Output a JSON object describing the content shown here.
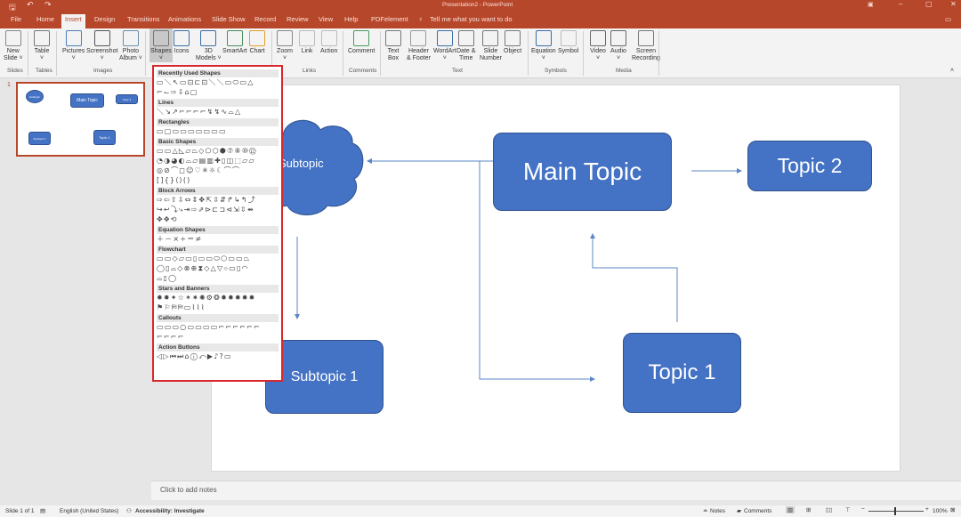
{
  "window": {
    "title": "Presentation2 - PowerPoint"
  },
  "tabs": [
    "File",
    "Home",
    "Insert",
    "Design",
    "Transitions",
    "Animations",
    "Slide Show",
    "Record",
    "Review",
    "View",
    "Help",
    "PDFelement"
  ],
  "active_tab": "Insert",
  "tell_me": "Tell me what you want to do",
  "ribbon": {
    "buttons": [
      {
        "label": "New\nSlide ˅",
        "icon": "new-slide-icon"
      },
      {
        "label": "Table\n˅",
        "icon": "table-icon"
      },
      {
        "label": "Pictures\n˅",
        "icon": "pictures-icon"
      },
      {
        "label": "Screenshot\n˅",
        "icon": "screenshot-icon"
      },
      {
        "label": "Photo\nAlbum ˅",
        "icon": "photo-album-icon"
      },
      {
        "label": "Shapes\n˅",
        "icon": "shapes-icon"
      },
      {
        "label": "Icons",
        "icon": "icons-icon"
      },
      {
        "label": "3D\nModels ˅",
        "icon": "3d-models-icon"
      },
      {
        "label": "SmartArt",
        "icon": "smartart-icon"
      },
      {
        "label": "Chart",
        "icon": "chart-icon"
      },
      {
        "label": "Zoom\n˅",
        "icon": "zoom-icon"
      },
      {
        "label": "Link",
        "icon": "link-icon"
      },
      {
        "label": "Action",
        "icon": "action-icon"
      },
      {
        "label": "Comment",
        "icon": "comment-icon"
      },
      {
        "label": "Text\nBox",
        "icon": "text-box-icon"
      },
      {
        "label": "Header\n& Footer",
        "icon": "header-footer-icon"
      },
      {
        "label": "WordArt\n˅",
        "icon": "wordart-icon"
      },
      {
        "label": "Date &\nTime",
        "icon": "date-time-icon"
      },
      {
        "label": "Slide\nNumber",
        "icon": "slide-number-icon"
      },
      {
        "label": "Object",
        "icon": "object-icon"
      },
      {
        "label": "Equation\n˅",
        "icon": "equation-icon"
      },
      {
        "label": "Symbol",
        "icon": "symbol-icon"
      },
      {
        "label": "Video\n˅",
        "icon": "video-icon"
      },
      {
        "label": "Audio\n˅",
        "icon": "audio-icon"
      },
      {
        "label": "Screen\nRecording",
        "icon": "screen-recording-icon"
      }
    ],
    "groups": [
      "Slides",
      "Tables",
      "Images",
      "Links",
      "Comments",
      "Text",
      "Symbols",
      "Media"
    ]
  },
  "shapes_panel": {
    "sections": [
      {
        "title": "Recently Used Shapes",
        "rows": [
          "▭＼↖▭⊡⊏⊡＼＼▭⬭▭△",
          "⌐⌙⇨⇩⌂▢"
        ]
      },
      {
        "title": "Lines",
        "rows": [
          "＼↘↗⌐⌐⌐⌐↯↯∿⌓△"
        ]
      },
      {
        "title": "Rectangles",
        "rows": [
          "▭▢▭▭▭▭▭▭▭"
        ]
      },
      {
        "title": "Basic Shapes",
        "rows": [
          "▭▭△◺▱⏢◇⬠⬡⬢⑦⑧⑩⑫",
          "◔◑◕◐⌓▱▤▥✚▯◫⬚▱▱",
          "◎⊘⌒◻☺♡✳☼☾⌒⌒",
          "[]{}⟨⟩()"
        ]
      },
      {
        "title": "Block Arrows",
        "rows": [
          "⇨⇦⇧⇩⇔⇕✥⇱⇳⇵↱↳↰⤴",
          "↪↩⤵⤷⇥⇨⇗⊳⊏⊐⊲⇲⇳⇴",
          "✥✥⟲"
        ]
      },
      {
        "title": "Equation Shapes",
        "rows": [
          "＋－×÷＝≠"
        ]
      },
      {
        "title": "Flowchart",
        "rows": [
          "▭▭◇▱▭▯▭▭⬭⬡▭▭⏢",
          "◯▯⌓◇⊗⊕⧗◇△▽⌔▭▯◠",
          "⌓▯◯"
        ]
      },
      {
        "title": "Stars and Banners",
        "rows": [
          "✹✸✦☆✶✷✺⚙❂✹✹✹✹✹",
          "⚑⚐⛿⛿▭⌇⌇⌇"
        ]
      },
      {
        "title": "Callouts",
        "rows": [
          "▭▭▭○▭▭▭▭⌐⌐⌐⌐⌐⌐",
          "⌐⌐⌐⌐"
        ]
      },
      {
        "title": "Action Buttons",
        "rows": [
          "◁▷⏮⏭⌂ⓘ⤺▶♪?▭"
        ]
      }
    ]
  },
  "thumbnail": {
    "number": "1",
    "labels": {
      "subtopic": "Subtopic",
      "main": "Main Topic",
      "topic2": "Topic 2",
      "sub1": "Subtopic 1",
      "topic1": "Topic 1"
    }
  },
  "slide": {
    "cloud": "Subtopic",
    "main_topic": "Main Topic",
    "topic2": "Topic 2",
    "subtopic1": "Subtopic 1",
    "topic1": "Topic 1",
    "fill": "#4472c4",
    "connector": "#5b87c5"
  },
  "notes_placeholder": "Click to add notes",
  "status": {
    "slide": "Slide 1 of 1",
    "language": "English (United States)",
    "accessibility": "Accessibility: Investigate",
    "notes": "Notes",
    "comments": "Comments",
    "zoom": "100%",
    "zoom_level": 100
  },
  "colors": {
    "accent": "#b7472a",
    "highlight": "#d9272e"
  }
}
